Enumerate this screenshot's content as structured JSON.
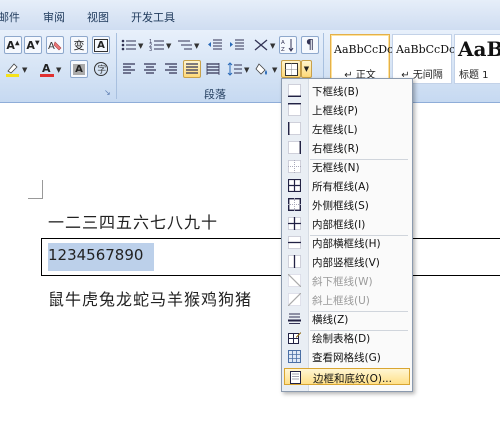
{
  "ribbon": {
    "tabs": [
      "邮件",
      "审阅",
      "视图",
      "开发工具"
    ],
    "paragraph_group_label": "段落",
    "styles": [
      {
        "sample": "AaBbCcDc",
        "name": "↵ 正文"
      },
      {
        "sample": "AaBbCcDc",
        "name": "↵ 无间隔"
      },
      {
        "sample": "AaB",
        "name": "标题 1"
      }
    ],
    "font_color": "#e03030",
    "highlight_color": "#f5e21a",
    "icons": [
      "grow-font-icon",
      "shrink-font-icon",
      "clear-format-icon",
      "phonetic-guide-icon",
      "char-border-icon",
      "bullets-icon",
      "numbering-icon",
      "multilevel-list-icon",
      "decrease-indent-icon",
      "increase-indent-icon",
      "chinese-layout-icon",
      "sort-icon",
      "show-marks-icon",
      "highlight-icon",
      "font-color-icon",
      "char-shading-icon",
      "enclose-char-icon",
      "align-left-icon",
      "center-icon",
      "align-right-icon",
      "justify-icon",
      "distributed-icon",
      "line-spacing-icon",
      "shading-icon",
      "borders-icon"
    ]
  },
  "document": {
    "line1": "一二三四五六七八九十",
    "selected_text": "1234567890",
    "line3": "鼠牛虎兔龙蛇马羊猴鸡狗猪"
  },
  "border_menu": {
    "items": [
      {
        "label": "下框线(B)",
        "icon": "bottom-border-icon",
        "enabled": true
      },
      {
        "label": "上框线(P)",
        "icon": "top-border-icon",
        "enabled": true
      },
      {
        "label": "左框线(L)",
        "icon": "left-border-icon",
        "enabled": true
      },
      {
        "label": "右框线(R)",
        "icon": "right-border-icon",
        "enabled": true
      },
      {
        "label": "无框线(N)",
        "icon": "no-border-icon",
        "enabled": true
      },
      {
        "label": "所有框线(A)",
        "icon": "all-borders-icon",
        "enabled": true
      },
      {
        "label": "外侧框线(S)",
        "icon": "outside-borders-icon",
        "enabled": true
      },
      {
        "label": "内部框线(I)",
        "icon": "inside-borders-icon",
        "enabled": true
      },
      {
        "label": "内部横框线(H)",
        "icon": "inside-horizontal-border-icon",
        "enabled": true
      },
      {
        "label": "内部竖框线(V)",
        "icon": "inside-vertical-border-icon",
        "enabled": true
      },
      {
        "label": "斜下框线(W)",
        "icon": "diagonal-down-border-icon",
        "enabled": false
      },
      {
        "label": "斜上框线(U)",
        "icon": "diagonal-up-border-icon",
        "enabled": false
      },
      {
        "label": "横线(Z)",
        "icon": "horizontal-line-icon",
        "enabled": true
      },
      {
        "label": "绘制表格(D)",
        "icon": "draw-table-icon",
        "enabled": true
      },
      {
        "label": "查看网格线(G)",
        "icon": "view-gridlines-icon",
        "enabled": true
      },
      {
        "label": "边框和底纹(O)...",
        "icon": "borders-and-shading-icon",
        "enabled": true,
        "highlighted": true
      }
    ]
  }
}
